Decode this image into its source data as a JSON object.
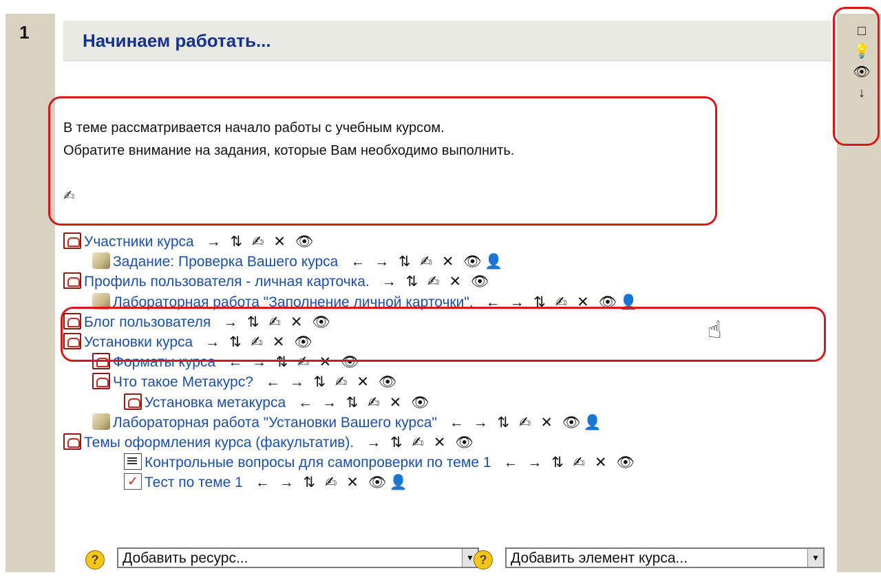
{
  "section": {
    "number": "1",
    "title": "Начинаем работать...",
    "summary_lines": [
      "В теме рассматривается начало работы с учебным курсом.",
      "Обратите внимание на задания, которые Вам необходимо выполнить."
    ]
  },
  "icons": {
    "edit": "✍",
    "left": "←",
    "right": "→",
    "updown": "⇅",
    "delete": "✕",
    "eye": "👁",
    "user": "👤",
    "down": "↓",
    "highlight": "💡",
    "box": "□",
    "help": "?",
    "hand": "☝"
  },
  "items": [
    {
      "label": "Участники курса",
      "icon": "pdf",
      "indent": 0,
      "actions": "→ ⇅ ✍ ✕ 👁"
    },
    {
      "label": "Задание: Проверка Вашего курса",
      "icon": "assignment",
      "indent": 1,
      "actions": "← → ⇅ ✍ ✕ 👁",
      "user": true
    },
    {
      "label": "Профиль пользователя - личная карточка.",
      "icon": "pdf",
      "indent": 0,
      "actions": "→ ⇅ ✍ ✕ 👁"
    },
    {
      "label": "Лабораторная работа \"Заполнение личной карточки\".",
      "icon": "assignment",
      "indent": 1,
      "actions": "← → ⇅ ✍ ✕ 👁",
      "user": true
    },
    {
      "label": "Блог пользователя",
      "icon": "pdf",
      "indent": 0,
      "actions": "→ ⇅ ✍ ✕ 👁"
    },
    {
      "label": "Установки курса",
      "icon": "pdf",
      "indent": 0,
      "actions": "→ ⇅ ✍ ✕ 👁"
    },
    {
      "label": "Форматы курса",
      "icon": "pdf",
      "indent": 1,
      "actions": "← → ⇅ ✍ ✕ 👁"
    },
    {
      "label": "Что такое Метакурс?",
      "icon": "pdf",
      "indent": 1,
      "actions": "← → ⇅ ✍ ✕ 👁"
    },
    {
      "label": "Установка метакурса",
      "icon": "pdf",
      "indent": 2,
      "actions": "← → ⇅ ✍ ✕ 👁"
    },
    {
      "label": "Лабораторная работа \"Установки Вашего курса\"",
      "icon": "assignment",
      "indent": 1,
      "actions": "← → ⇅ ✍ ✕ 👁",
      "user": true
    },
    {
      "label": "Темы оформления курса (факультатив).",
      "icon": "pdf",
      "indent": 0,
      "actions": "→ ⇅ ✍ ✕ 👁"
    },
    {
      "label": "Контрольные вопросы для самопроверки по теме 1",
      "icon": "document",
      "indent": 2,
      "actions": "← → ⇅ ✍ ✕ 👁"
    },
    {
      "label": "Тест по теме 1",
      "icon": "quiz",
      "indent": 2,
      "actions": "← → ⇅ ✍ ✕ 👁",
      "user": true
    }
  ],
  "add_resource": {
    "selected": "Добавить ресурс..."
  },
  "add_activity": {
    "selected": "Добавить элемент курса..."
  },
  "colors": {
    "link": "#1c4fa5",
    "title": "#16328a",
    "highlight_box": "#d81818",
    "section_bar": "#d9d2c1",
    "header_bg": "#e9e9e4"
  }
}
